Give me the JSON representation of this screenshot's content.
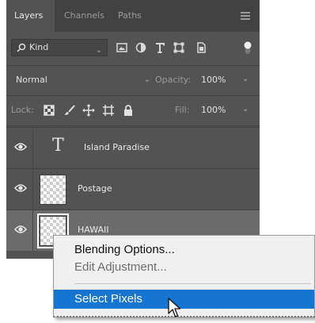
{
  "tabs": [
    {
      "label": "Layers"
    },
    {
      "label": "Channels"
    },
    {
      "label": "Paths"
    }
  ],
  "filter": {
    "kind_label": "Kind"
  },
  "blend": {
    "mode": "Normal",
    "opacity_label": "Opacity:",
    "opacity_value": "100%"
  },
  "lock": {
    "label": "Lock:",
    "fill_label": "Fill:",
    "fill_value": "100%"
  },
  "layers": [
    {
      "name": "Island Paradise",
      "type": "text"
    },
    {
      "name": "Postage",
      "type": "image"
    },
    {
      "name": "HAWAII",
      "type": "image",
      "selected": true
    }
  ],
  "context_menu": {
    "items": [
      {
        "label": "Blending Options...",
        "enabled": true
      },
      {
        "label": "Edit Adjustment...",
        "enabled": false
      },
      {
        "label": "Select Pixels",
        "highlighted": true
      }
    ]
  },
  "colors": {
    "panel_bg": "#535353",
    "highlight": "#1675d1"
  }
}
